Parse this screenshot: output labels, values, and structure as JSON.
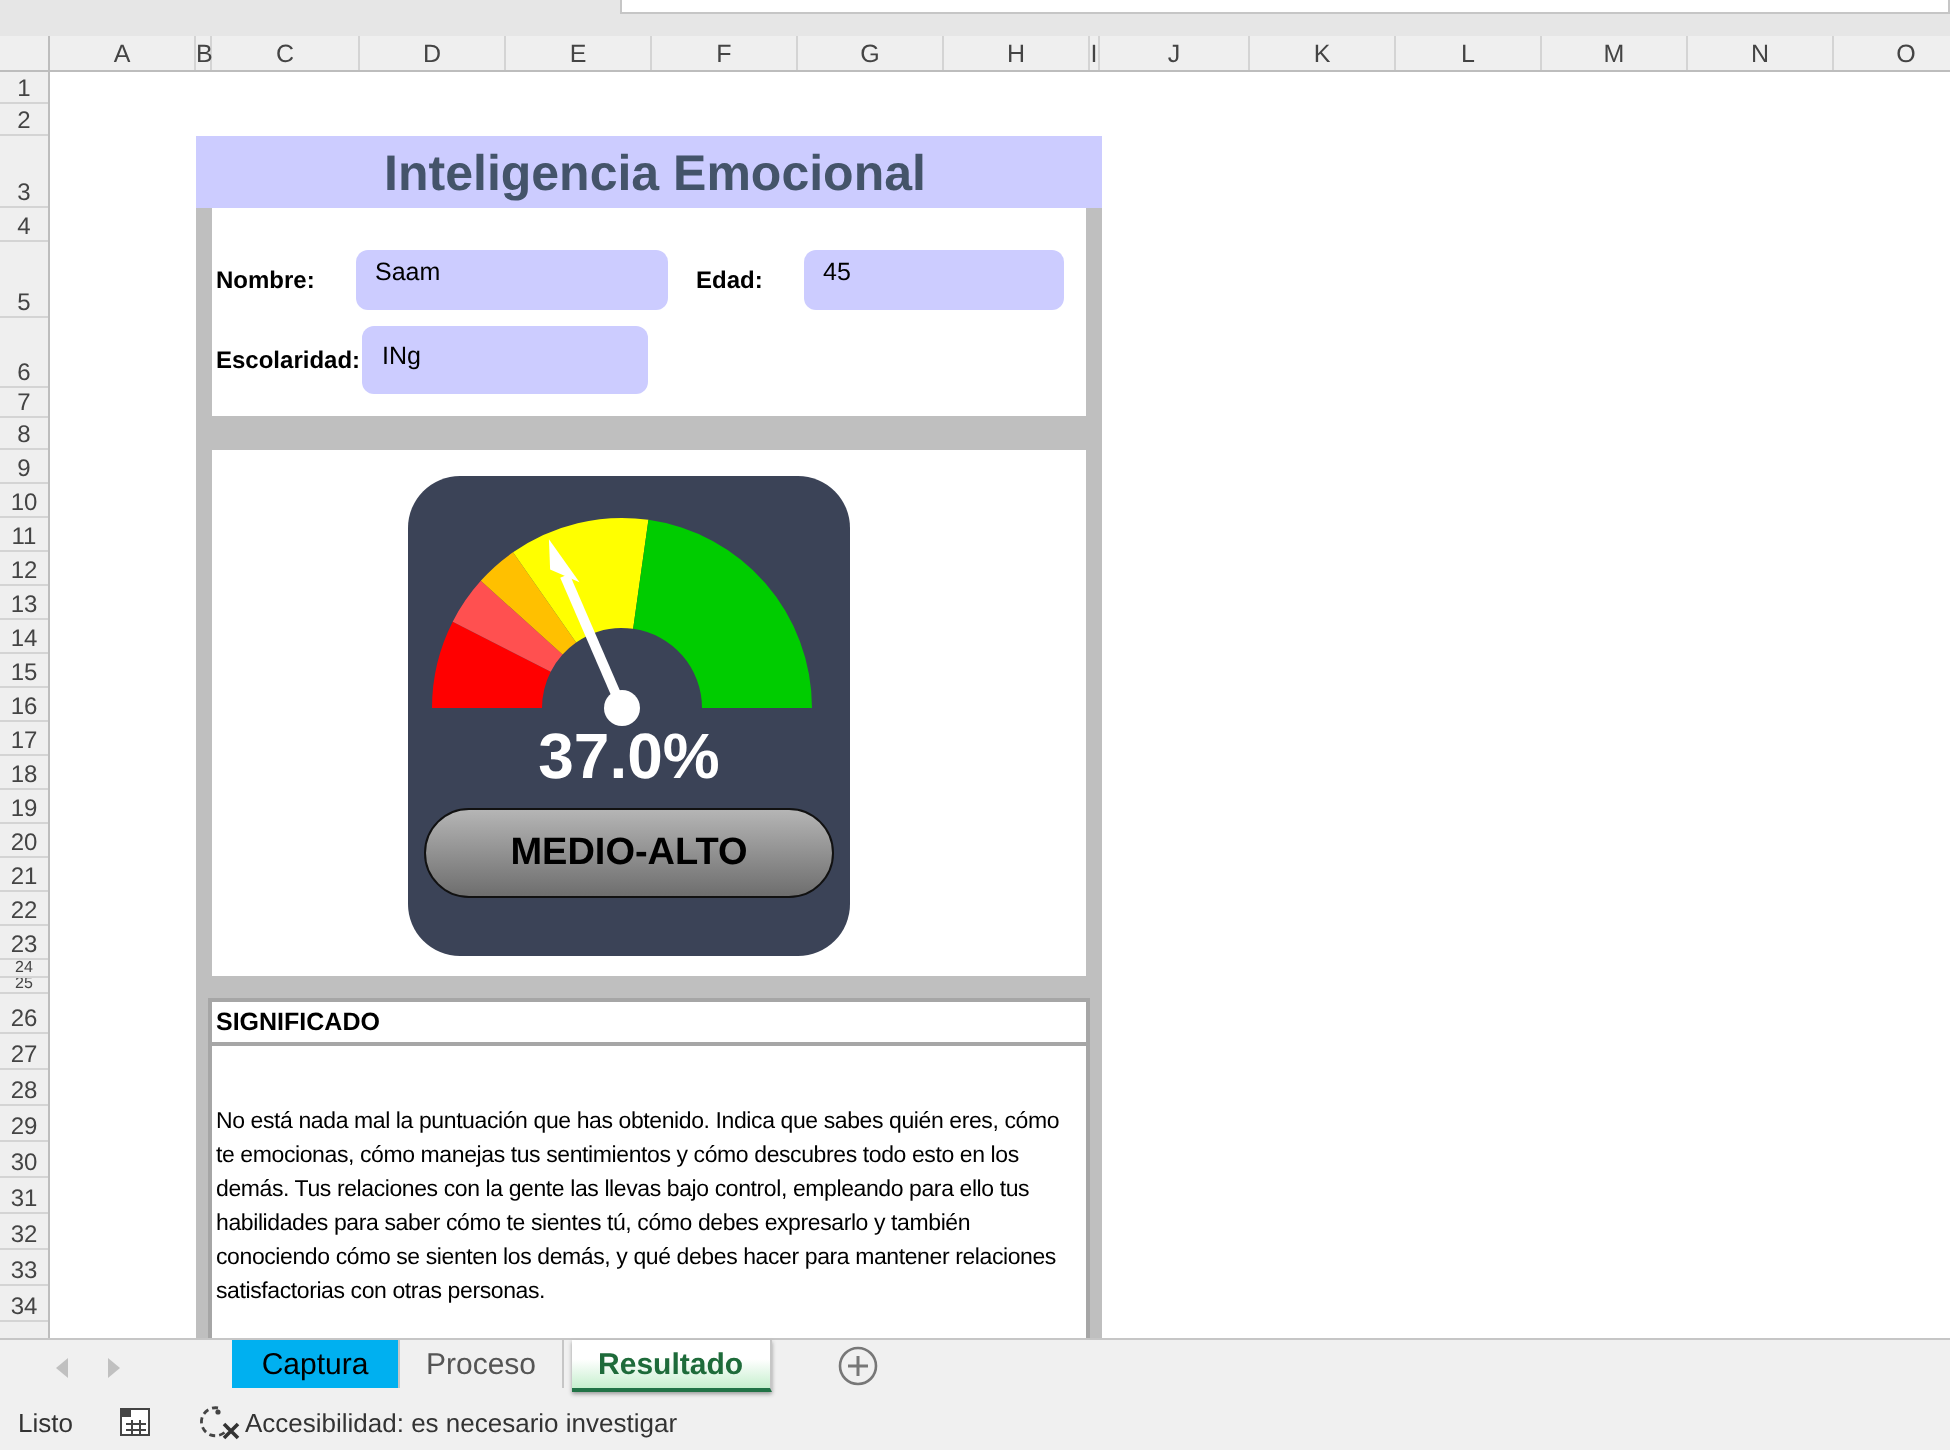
{
  "columns": [
    "A",
    "B",
    "C",
    "D",
    "E",
    "F",
    "G",
    "H",
    "I",
    "J",
    "K",
    "L",
    "M",
    "N",
    "O"
  ],
  "rows": [
    "1",
    "2",
    "3",
    "4",
    "5",
    "6",
    "7",
    "8",
    "9",
    "10",
    "11",
    "12",
    "13",
    "14",
    "15",
    "16",
    "17",
    "18",
    "19",
    "20",
    "21",
    "22",
    "23",
    "24",
    "25",
    "26",
    "27",
    "28",
    "29",
    "30",
    "31",
    "32",
    "33",
    "34"
  ],
  "title": "Inteligencia Emocional",
  "form": {
    "fields": [
      {
        "label": "Nombre:",
        "value": "Saam"
      },
      {
        "label": "Edad:",
        "value": "45"
      },
      {
        "label": "Escolaridad:",
        "value": "INg"
      }
    ]
  },
  "gauge": {
    "level": 0.37,
    "reading": "37.0%",
    "category": "MEDIO-ALTO"
  },
  "significado": {
    "heading": "SIGNIFICADO",
    "text": "No está nada mal la puntuación que has obtenido. Indica que sabes quién eres, cómo te emocionas, cómo manejas tus sentimientos y cómo descubres todo esto en los demás. Tus relaciones con la gente las llevas bajo control, empleando para ello tus habilidades para saber cómo te sientes tú, cómo debes expresarlo y también conociendo cómo se sienten los demás, y qué debes hacer para mantener relaciones satisfactorias con otras personas."
  },
  "sheet_tabs": [
    {
      "label": "Captura",
      "selected": false,
      "color": "#00b0f0"
    },
    {
      "label": "Proceso",
      "selected": false
    },
    {
      "label": "Resultado",
      "selected": true
    }
  ],
  "status_bar": {
    "mode": "Listo",
    "accessibility": "Accesibilidad: es necesario investigar"
  }
}
